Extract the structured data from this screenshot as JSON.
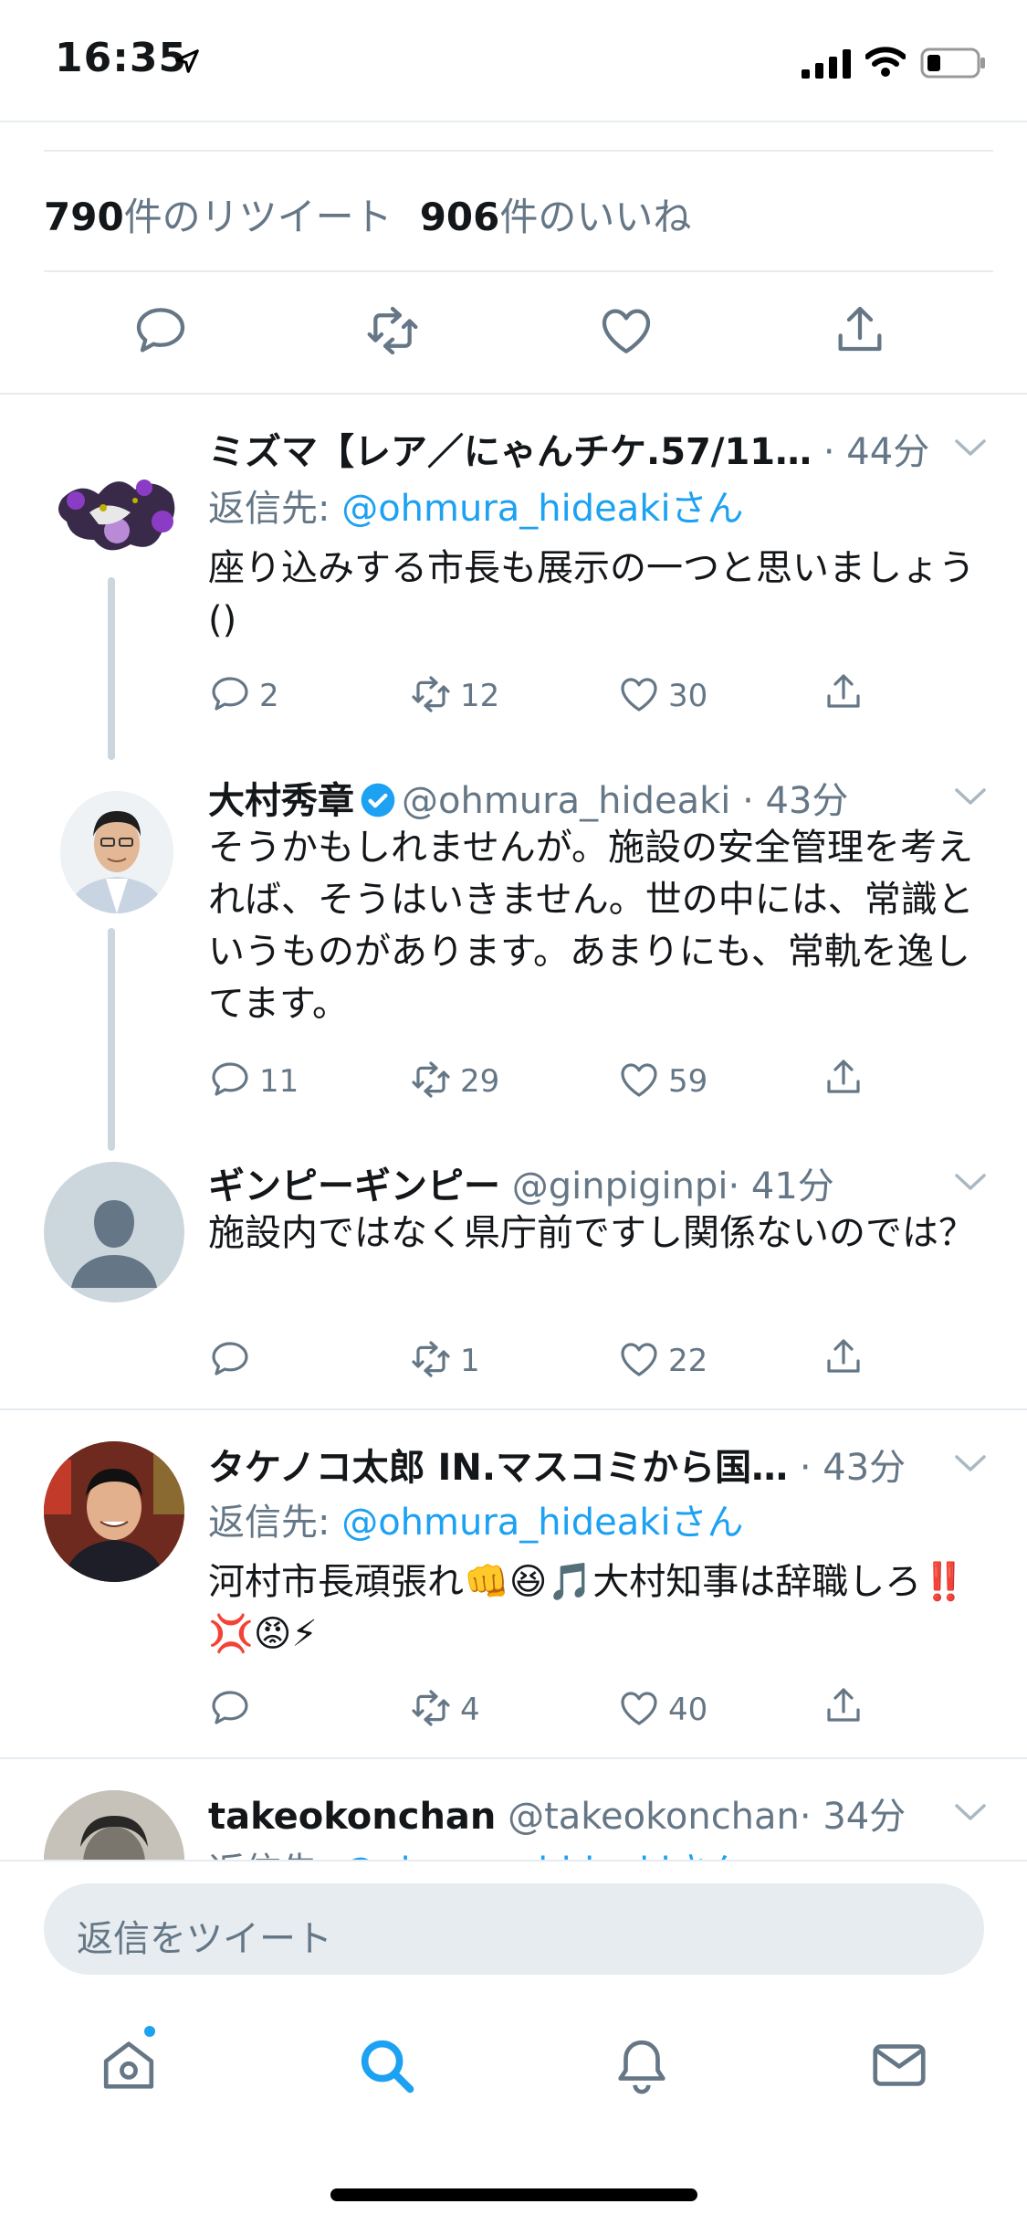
{
  "status_bar": {
    "time": "16:35"
  },
  "tweet_stats": {
    "retweet_count": "790",
    "retweet_label": "件のリツイート",
    "like_count": "906",
    "like_label": "件のいいね"
  },
  "replies": [
    {
      "name": "ミズマ【レア／にゃんチケ.57/11…",
      "handle": "",
      "time": "· 44分",
      "reply_to_prefix": "返信先: ",
      "reply_to_mention": "@ohmura_hideaki",
      "reply_to_suffix": "さん",
      "text": "座り込みする市長も展示の一つと思いましょう()",
      "replies": "2",
      "retweets": "12",
      "likes": "30"
    },
    {
      "name": "大村秀章",
      "verified": true,
      "handle": "@ohmura_hideaki",
      "time": "· 43分",
      "text": "そうかもしれませんが。施設の安全管理を考えれば、そうはいきません。世の中には、常識というものがあります。あまりにも、常軌を逸してます。",
      "replies": "11",
      "retweets": "29",
      "likes": "59"
    },
    {
      "name": "ギンピーギンピー",
      "handle": "@ginpiginpi",
      "time": "· 41分",
      "text": "施設内ではなく県庁前ですし関係ないのでは？",
      "replies": "",
      "retweets": "1",
      "likes": "22"
    },
    {
      "name": "タケノコ太郎 IN.マスコミから国…",
      "handle": "",
      "time": "· 43分",
      "reply_to_prefix": "返信先: ",
      "reply_to_mention": "@ohmura_hideaki",
      "reply_to_suffix": "さん",
      "text": "河村市長頑張れ👊😆🎵大村知事は辞職しろ‼️💢😡⚡",
      "replies": "",
      "retweets": "4",
      "likes": "40"
    },
    {
      "name": "takeokonchan",
      "handle": "@takeokonchan",
      "time": "· 34分",
      "reply_to_prefix": "返信先: ",
      "reply_to_mention": "@ohmura_hideaki",
      "reply_to_suffix": "さん"
    }
  ],
  "reply_input": {
    "placeholder": "返信をツイート"
  },
  "colors": {
    "accent": "#1da1f2",
    "secondary_text": "#657786",
    "divider": "#e6ecf0",
    "thread_line": "#ccd6dd"
  },
  "tab_bar": {
    "icons": [
      "home-icon",
      "search-icon",
      "notifications-icon",
      "messages-icon"
    ],
    "active": "search-icon"
  }
}
